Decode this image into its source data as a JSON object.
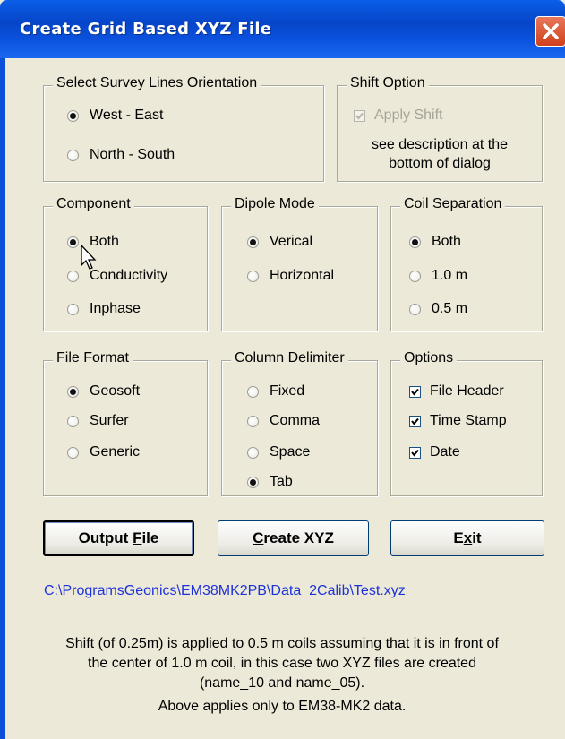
{
  "window": {
    "title": "Create Grid Based XYZ File"
  },
  "orientation": {
    "legend": "Select Survey Lines Orientation",
    "options": [
      {
        "label": "West - East",
        "selected": true
      },
      {
        "label": "North - South",
        "selected": false
      }
    ]
  },
  "shift": {
    "legend": "Shift Option",
    "checkbox_label": "Apply Shift",
    "checked": true,
    "disabled": true,
    "description_line1": "see description at the",
    "description_line2": "bottom of dialog"
  },
  "component": {
    "legend": "Component",
    "options": [
      {
        "label": "Both",
        "selected": true
      },
      {
        "label": "Conductivity",
        "selected": false
      },
      {
        "label": "Inphase",
        "selected": false
      }
    ]
  },
  "dipole": {
    "legend": "Dipole Mode",
    "options": [
      {
        "label": "Verical",
        "selected": true
      },
      {
        "label": "Horizontal",
        "selected": false
      }
    ]
  },
  "coil": {
    "legend": "Coil Separation",
    "options": [
      {
        "label": "Both",
        "selected": true
      },
      {
        "label": "1.0 m",
        "selected": false
      },
      {
        "label": "0.5 m",
        "selected": false
      }
    ]
  },
  "file_format": {
    "legend": "File Format",
    "options": [
      {
        "label": "Geosoft",
        "selected": true
      },
      {
        "label": "Surfer",
        "selected": false
      },
      {
        "label": "Generic",
        "selected": false
      }
    ]
  },
  "delimiter": {
    "legend": "Column Delimiter",
    "options": [
      {
        "label": "Fixed",
        "selected": false
      },
      {
        "label": "Comma",
        "selected": false
      },
      {
        "label": "Space",
        "selected": false
      },
      {
        "label": "Tab",
        "selected": true
      }
    ]
  },
  "options": {
    "legend": "Options",
    "items": [
      {
        "label": "File Header",
        "checked": true
      },
      {
        "label": "Time Stamp",
        "checked": true
      },
      {
        "label": "Date",
        "checked": true
      }
    ]
  },
  "buttons": {
    "output_prefix": "Output ",
    "output_accel": "F",
    "output_rest": "ile",
    "create_accel": "C",
    "create_rest": "reate XYZ",
    "exit_prefix": "E",
    "exit_accel": "x",
    "exit_rest": "it"
  },
  "output_path": "C:\\ProgramsGeonics\\EM38MK2PB\\Data_2Calib\\Test.xyz",
  "notes": {
    "line1": "Shift (of 0.25m) is applied to 0.5 m coils assuming that it is in front of",
    "line2": "the center of 1.0 m coil,  in this case two XYZ files are created",
    "line3": "(name_10 and name_05).",
    "line4": "Above applies only to EM38-MK2 data."
  },
  "colors": {
    "title_bar": "#0645c8",
    "dialog_bg": "#ece9d8",
    "path_text": "#1e32d9",
    "close_button": "#d0401c"
  },
  "icons": [
    "close-icon",
    "mouse-cursor-icon",
    "checkmark-icon"
  ]
}
